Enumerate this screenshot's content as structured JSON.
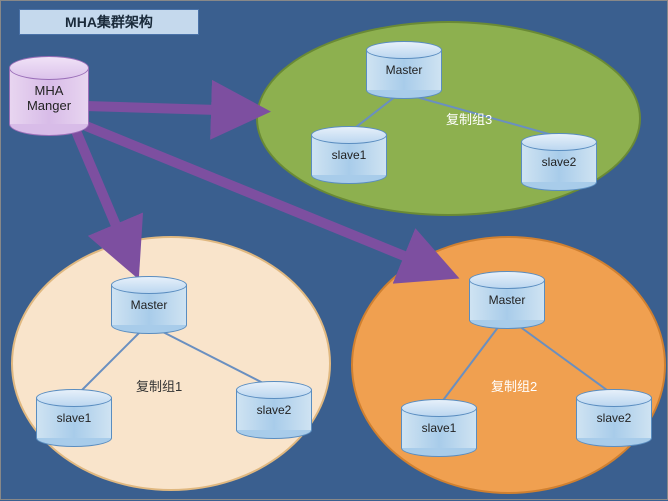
{
  "title": "MHA集群架构",
  "manager": {
    "label": "MHA\nManger"
  },
  "groups": [
    {
      "id": "group3",
      "label": "复制组3",
      "master": "Master",
      "slave1": "slave1",
      "slave2": "slave2"
    },
    {
      "id": "group1",
      "label": "复制组1",
      "master": "Master",
      "slave1": "slave1",
      "slave2": "slave2"
    },
    {
      "id": "group2",
      "label": "复制组2",
      "master": "Master",
      "slave1": "slave1",
      "slave2": "slave2"
    }
  ]
}
